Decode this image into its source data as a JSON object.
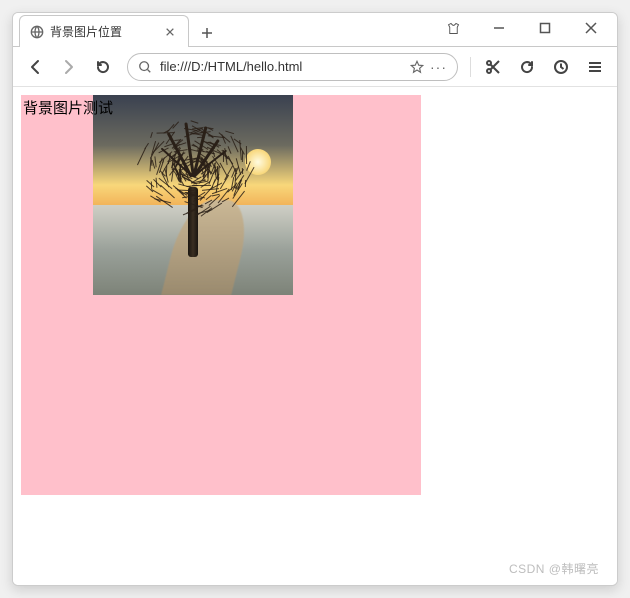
{
  "window": {
    "minimize_tooltip": "Minimize",
    "maximize_tooltip": "Maximize",
    "close_tooltip": "Close"
  },
  "tabs": [
    {
      "title": "背景图片位置"
    }
  ],
  "toolbar": {
    "back_tooltip": "Back",
    "forward_tooltip": "Forward",
    "reload_tooltip": "Reload",
    "url": "file:///D:/HTML/hello.html",
    "star_tooltip": "Bookmark",
    "more_label": "···",
    "scissors_tooltip": "Snip",
    "undo_tooltip": "Undo",
    "clock_tooltip": "History",
    "menu_tooltip": "Menu"
  },
  "page": {
    "box_text": "背景图片测试",
    "background_color": "#ffc0cb"
  },
  "watermark": "CSDN @韩曙亮"
}
